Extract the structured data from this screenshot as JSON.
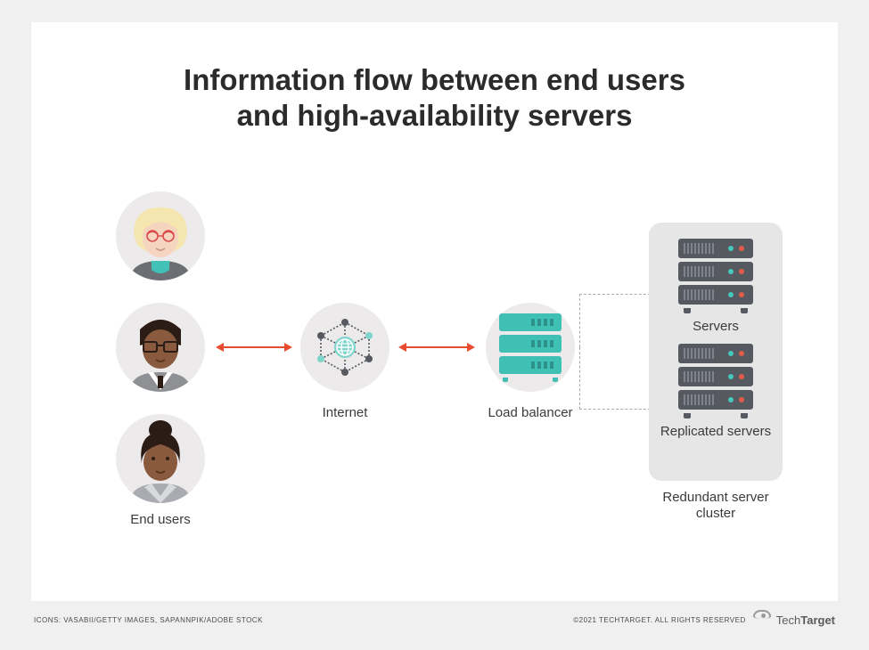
{
  "title_line1": "Information flow between end users",
  "title_line2": "and high-availability servers",
  "labels": {
    "end_users": "End users",
    "internet": "Internet",
    "load_balancer": "Load balancer",
    "servers": "Servers",
    "replicated_servers": "Replicated servers",
    "cluster": "Redundant server cluster"
  },
  "attribution": {
    "icons": "Icons: VASABII/Getty Images, Sapannpik/Adobe Stock",
    "copyright": "©2021 TechTarget. All Rights Reserved",
    "brand_a": "Tech",
    "brand_b": "Target"
  },
  "colors": {
    "accent_teal": "#40bfb4",
    "arrow_red": "#e84b2f",
    "server_gray": "#565960"
  }
}
